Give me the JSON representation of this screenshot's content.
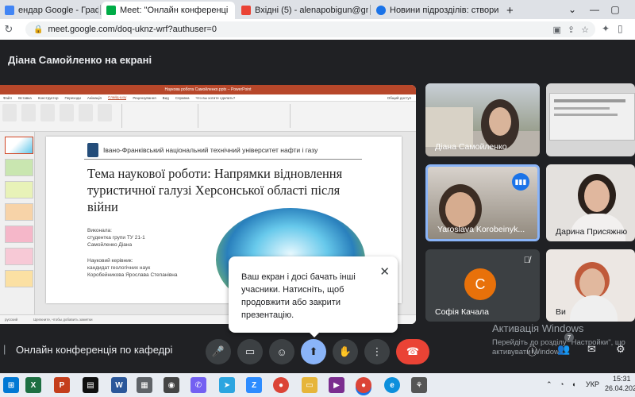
{
  "browser": {
    "tabs": [
      {
        "title": "ендар Google - Графік почин",
        "color": "#4285f4"
      },
      {
        "title": "Meet: \"Онлайн конференці",
        "color": "#00ac47"
      },
      {
        "title": "Вхідні (5) - alenapobigun@gmail",
        "color": "#ea4335"
      },
      {
        "title": "Новини підрозділів: створити |",
        "color": "#1a73e8"
      }
    ],
    "new_tab": "+",
    "url": "meet.google.com/doq-uknz-wrf?authuser=0"
  },
  "meet": {
    "presenting_title": "Діана Самойленко на екрані",
    "meeting_name": "Онлайн конференція по кафедрі",
    "participant_count": "7"
  },
  "ppt": {
    "window_title": "Наукова робота Самойленко.pptx – PowerPoint",
    "menu": [
      "Файл",
      "Вставка",
      "Конструктор",
      "Переходи",
      "Анімація",
      "Слайд-шоу",
      "Рецензування",
      "Вид",
      "Справка",
      "Что вы хотите сделать?"
    ],
    "active_menu": "Слайд-шоу",
    "share": "Общий доступ",
    "status_left": "Щелкните, чтобы добавить заметки",
    "status_lang": "русский"
  },
  "slide": {
    "university": "Івано-Франківський національний технічний університет нафти і газу",
    "title": "Тема наукової роботи: Напрямки відновлення туристичної галузі Херсонської області після війни",
    "performed_label": "Виконала:",
    "student_group": "студентка групи ТУ 21-1",
    "student_name": "Самойленко Діана",
    "supervisor_label": "Науковий керівник:",
    "supervisor_title": "кандидат геологічних наук",
    "supervisor_name": "Коробейникова Ярослава Степанівна"
  },
  "participants": [
    {
      "name": "Діана Самойленко"
    },
    {
      "name": "Yaroslava Korobeinyk..."
    },
    {
      "name": "Дарина Присяжню"
    },
    {
      "name": "Софія Качала",
      "initial": "С"
    },
    {
      "name": "Ви"
    }
  ],
  "popup": {
    "text": "Ваш екран і досі бачать інші учасники. Натисніть, щоб продовжити або закрити презентацію."
  },
  "watermark": {
    "line1": "Активація Windows",
    "line2": "Перейдіть до розділу \"Настройки\", що активувати Windows."
  },
  "system": {
    "lang": "УКР",
    "time": "15:31",
    "date": "26.04.2023"
  },
  "colors": {
    "meet_bg": "#202124",
    "hangup": "#ea4335",
    "ppt_accent": "#b7472a",
    "speaker_blue": "#1a73e8",
    "avatar_orange": "#e8710a"
  }
}
